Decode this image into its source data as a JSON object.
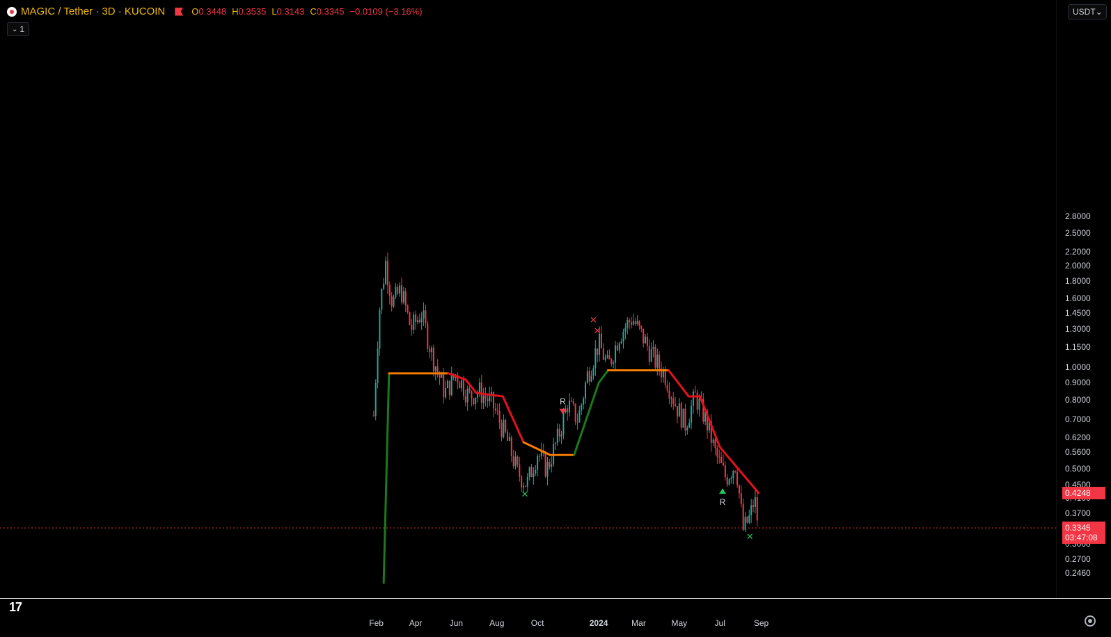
{
  "header": {
    "symbol_title": "MAGIC / Tether · 3D · KUCOIN",
    "ohlc": {
      "o_label": "O",
      "o": "0.3448",
      "h_label": "H",
      "h": "0.3535",
      "l_label": "L",
      "l": "0.3143",
      "c_label": "C",
      "c": "0.3345",
      "change": "−0.0109 (−3.16%)"
    },
    "interval_count": "1"
  },
  "price_scale": {
    "currency": "USDT",
    "ticks": [
      "2.8000",
      "2.5000",
      "2.2000",
      "2.0000",
      "1.8000",
      "1.6000",
      "1.4500",
      "1.3000",
      "1.1500",
      "1.0000",
      "0.9000",
      "0.8000",
      "0.7000",
      "0.6200",
      "0.5600",
      "0.5000",
      "0.4500",
      "0.4100",
      "0.3700",
      "0.3000",
      "0.2700",
      "0.2460"
    ],
    "indicator_badge": "0.4248",
    "last_price_badge": "0.3345",
    "countdown": "03:47:08"
  },
  "time_axis": {
    "labels": [
      "Feb",
      "Apr",
      "Jun",
      "Aug",
      "Oct",
      "2024",
      "Mar",
      "May",
      "Jul",
      "Sep"
    ],
    "bold_label": "2024"
  },
  "colors": {
    "up": "#26a69a",
    "down": "#f23645",
    "indicator_bull": "#1b7a1b",
    "indicator_flat": "#f57c00",
    "indicator_bear": "#e5121d",
    "background": "#000000"
  },
  "chart_data": {
    "type": "candlestick",
    "title": "MAGIC / Tether · 3D · KUCOIN",
    "log_scale": true,
    "ylim": [
      0.23,
      3.0
    ],
    "close_series": [
      {
        "date": "2023-01-28",
        "close": 0.72
      },
      {
        "date": "2023-02-05",
        "close": 1.45
      },
      {
        "date": "2023-02-15",
        "close": 2.05
      },
      {
        "date": "2023-02-25",
        "close": 1.55
      },
      {
        "date": "2023-03-10",
        "close": 1.7
      },
      {
        "date": "2023-03-25",
        "close": 1.3
      },
      {
        "date": "2023-04-10",
        "close": 1.45
      },
      {
        "date": "2023-04-25",
        "close": 1.1
      },
      {
        "date": "2023-05-15",
        "close": 0.84
      },
      {
        "date": "2023-06-01",
        "close": 0.96
      },
      {
        "date": "2023-06-20",
        "close": 0.82
      },
      {
        "date": "2023-07-05",
        "close": 0.85
      },
      {
        "date": "2023-07-25",
        "close": 0.78
      },
      {
        "date": "2023-08-15",
        "close": 0.62
      },
      {
        "date": "2023-09-01",
        "close": 0.49
      },
      {
        "date": "2023-09-15",
        "close": 0.45
      },
      {
        "date": "2023-10-01",
        "close": 0.56
      },
      {
        "date": "2023-10-15",
        "close": 0.5
      },
      {
        "date": "2023-11-01",
        "close": 0.62
      },
      {
        "date": "2023-11-15",
        "close": 0.78
      },
      {
        "date": "2023-12-01",
        "close": 0.7
      },
      {
        "date": "2023-12-15",
        "close": 0.95
      },
      {
        "date": "2024-01-01",
        "close": 1.18
      },
      {
        "date": "2024-01-15",
        "close": 1.0
      },
      {
        "date": "2024-02-01",
        "close": 1.25
      },
      {
        "date": "2024-02-20",
        "close": 1.4
      },
      {
        "date": "2024-03-10",
        "close": 1.2
      },
      {
        "date": "2024-03-25",
        "close": 1.05
      },
      {
        "date": "2024-04-10",
        "close": 0.95
      },
      {
        "date": "2024-04-25",
        "close": 0.78
      },
      {
        "date": "2024-05-10",
        "close": 0.68
      },
      {
        "date": "2024-05-25",
        "close": 0.82
      },
      {
        "date": "2024-06-10",
        "close": 0.7
      },
      {
        "date": "2024-06-25",
        "close": 0.55
      },
      {
        "date": "2024-07-10",
        "close": 0.47
      },
      {
        "date": "2024-07-25",
        "close": 0.52
      },
      {
        "date": "2024-08-05",
        "close": 0.33
      },
      {
        "date": "2024-08-15",
        "close": 0.36
      },
      {
        "date": "2024-08-22",
        "close": 0.41
      },
      {
        "date": "2024-08-28",
        "close": 0.3345
      }
    ],
    "indicator_line": [
      {
        "date": "2023-02-12",
        "value": 0.23,
        "state": "bull"
      },
      {
        "date": "2023-02-20",
        "value": 0.96,
        "state": "bull"
      },
      {
        "date": "2023-05-20",
        "value": 0.96,
        "state": "flat"
      },
      {
        "date": "2023-06-15",
        "value": 0.92,
        "state": "bear"
      },
      {
        "date": "2023-07-01",
        "value": 0.84,
        "state": "bear"
      },
      {
        "date": "2023-08-10",
        "value": 0.82,
        "state": "bear"
      },
      {
        "date": "2023-09-10",
        "value": 0.6,
        "state": "bear"
      },
      {
        "date": "2023-10-20",
        "value": 0.55,
        "state": "flat"
      },
      {
        "date": "2023-11-25",
        "value": 0.55,
        "state": "flat"
      },
      {
        "date": "2024-01-01",
        "value": 0.9,
        "state": "bull"
      },
      {
        "date": "2024-01-15",
        "value": 0.98,
        "state": "bull"
      },
      {
        "date": "2024-04-15",
        "value": 0.98,
        "state": "flat"
      },
      {
        "date": "2024-05-15",
        "value": 0.82,
        "state": "bear"
      },
      {
        "date": "2024-06-01",
        "value": 0.82,
        "state": "bear"
      },
      {
        "date": "2024-07-01",
        "value": 0.58,
        "state": "bear"
      },
      {
        "date": "2024-08-28",
        "value": 0.4248,
        "state": "bear"
      }
    ],
    "markers": [
      {
        "date": "2023-09-12",
        "price": 0.42,
        "shape": "x",
        "color": "green",
        "label": ""
      },
      {
        "date": "2023-11-08",
        "price": 0.74,
        "shape": "triangle-down",
        "color": "red",
        "label": "R"
      },
      {
        "date": "2023-12-24",
        "price": 1.38,
        "shape": "x",
        "color": "red",
        "label": ""
      },
      {
        "date": "2023-12-30",
        "price": 1.28,
        "shape": "x",
        "color": "red",
        "label": ""
      },
      {
        "date": "2024-07-05",
        "price": 0.43,
        "shape": "triangle-up",
        "color": "green",
        "label": "R"
      },
      {
        "date": "2024-08-15",
        "price": 0.315,
        "shape": "x",
        "color": "green",
        "label": ""
      }
    ]
  }
}
